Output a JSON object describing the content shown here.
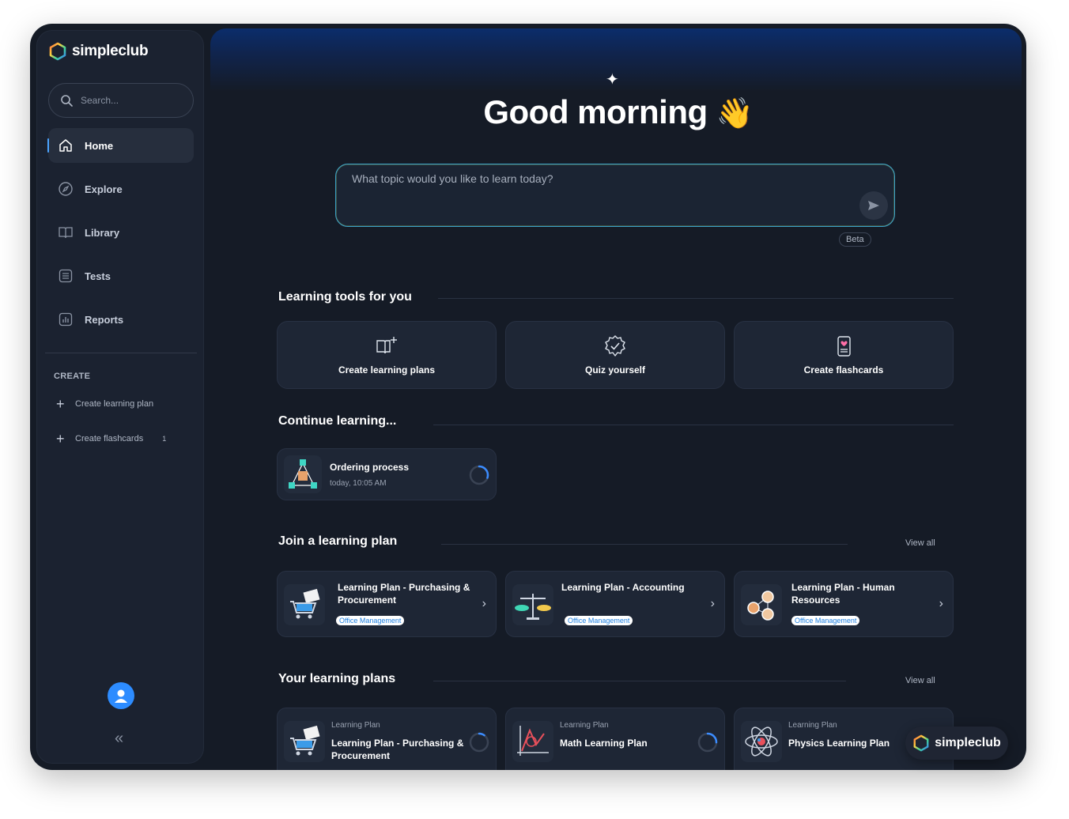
{
  "brand": {
    "name": "simpleclub"
  },
  "sidebar": {
    "search_placeholder": "Search...",
    "nav": [
      {
        "label": "Home",
        "icon": "home-icon",
        "active": true
      },
      {
        "label": "Explore",
        "icon": "compass-icon"
      },
      {
        "label": "Library",
        "icon": "book-icon"
      },
      {
        "label": "Tests",
        "icon": "checklist-icon"
      },
      {
        "label": "Reports",
        "icon": "bar-chart-icon"
      }
    ],
    "create_title": "CREATE",
    "create_items": [
      {
        "label": "Create learning plan",
        "badge": ""
      },
      {
        "label": "Create flashcards",
        "badge": "1"
      }
    ]
  },
  "main": {
    "greeting": "Good morning",
    "greeting_emoji": "👋",
    "prompt_placeholder": "What topic would you like to learn today?",
    "beta_label": "Beta",
    "tools": {
      "title": "Learning tools for you",
      "items": [
        {
          "label": "Create learning plans",
          "icon": "book-plus-icon"
        },
        {
          "label": "Quiz yourself",
          "icon": "check-badge-icon"
        },
        {
          "label": "Create flashcards",
          "icon": "flashcard-icon"
        }
      ]
    },
    "continue": {
      "title": "Continue learning...",
      "items": [
        {
          "title": "Ordering process",
          "time": "today, 10:05 AM",
          "progress": 0.3
        }
      ]
    },
    "join": {
      "title": "Join a learning plan",
      "view_all": "View all",
      "items": [
        {
          "title": "Learning Plan - Purchasing & Procurement",
          "tag": "Office Management"
        },
        {
          "title": "Learning Plan - Accounting",
          "tag": "Office Management"
        },
        {
          "title": "Learning Plan - Human Resources",
          "tag": "Office Management"
        }
      ]
    },
    "mine": {
      "title": "Your learning plans",
      "view_all": "View all",
      "items": [
        {
          "kind": "Learning Plan",
          "title": "Learning Plan - Purchasing & Procurement",
          "progress": 0.1
        },
        {
          "kind": "Learning Plan",
          "title": "Math Learning Plan",
          "progress": 0.25
        },
        {
          "kind": "Learning Plan",
          "title": "Physics Learning Plan",
          "progress": 0
        }
      ]
    }
  },
  "colors": {
    "accent": "#2d8cff",
    "background": "#151b26",
    "card": "#1e2635"
  }
}
